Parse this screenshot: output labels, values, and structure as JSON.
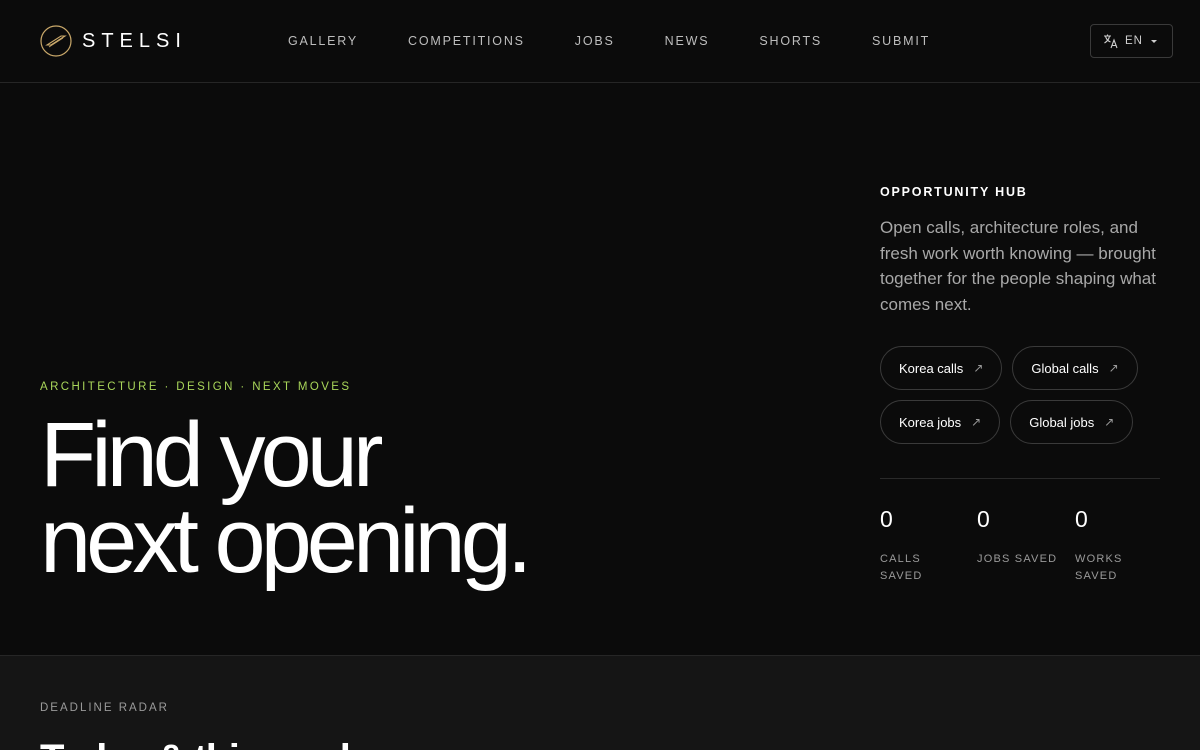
{
  "header": {
    "brand": "STELSI",
    "nav": [
      "GALLERY",
      "COMPETITIONS",
      "JOBS",
      "NEWS",
      "SHORTS",
      "SUBMIT"
    ],
    "language": "EN"
  },
  "hero": {
    "eyebrow": "ARCHITECTURE · DESIGN · NEXT MOVES",
    "title_line1": "Find your",
    "title_line2": "next opening."
  },
  "hub": {
    "label": "OPPORTUNITY HUB",
    "description": "Open calls, architecture roles, and fresh work worth knowing — brought together for the people shaping what comes next.",
    "links": [
      "Korea calls",
      "Global calls",
      "Korea jobs",
      "Global jobs"
    ],
    "stats": [
      {
        "value": "0",
        "label": "CALLS SAVED"
      },
      {
        "value": "0",
        "label": "JOBS SAVED"
      },
      {
        "value": "0",
        "label": "WORKS SAVED"
      }
    ]
  },
  "deadline": {
    "label": "DEADLINE RADAR",
    "title": "Today & this week"
  },
  "colors": {
    "background": "#0b0b0b",
    "accent": "#a9d65a",
    "section": "#151515"
  },
  "icons": {
    "logo": "stelsi-logo-icon",
    "language": "translate-icon",
    "link": "arrow-up-right-icon"
  }
}
